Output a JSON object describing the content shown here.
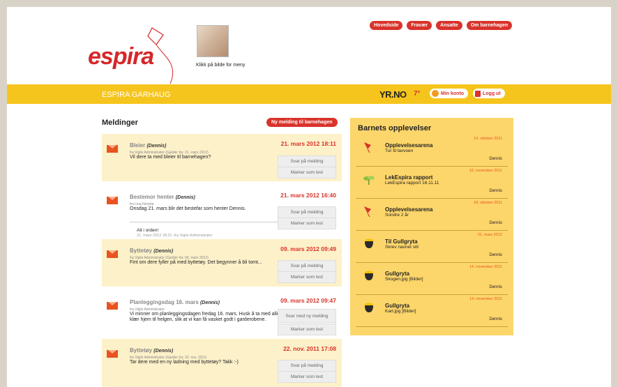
{
  "header": {
    "logo_text": "espira",
    "avatar_caption": "Klikk på bilde for meny",
    "nav": [
      "Hovedside",
      "Fravær",
      "Ansatte",
      "Om barnehagen"
    ]
  },
  "bar": {
    "title": "ESPIRA GARHAUG",
    "yr": "YR.NO",
    "temperature": "7°",
    "account": "Min konto",
    "logout": "Logg ut"
  },
  "messages": {
    "title": "Meldinger",
    "new_button": "Ny melding til barnehagen",
    "items": [
      {
        "subject": "Bleier",
        "child": "(Dennis)",
        "from": "fra Vigilo Administrator (Gjelder fra: 21. mars 2012)",
        "body": "Vil dere ta med bleier til barnehagen?",
        "date": "21. mars 2012 18:11",
        "reply": "Svar på melding",
        "mark": "Marker som lest"
      },
      {
        "subject": "Bestemor henter",
        "child": "(Dennis)",
        "from": "fra Lina Noreba",
        "body": "Onsdag 21. mars blir det bestefar som henter Dennis.",
        "date": "21. mars 2012 16:40",
        "reply": "Svar på melding",
        "mark": "Marker som lest",
        "answer_text": "Alt i orden!",
        "answer_meta": "21. mars 2012 18:21, fra Vigilo Administrator"
      },
      {
        "subject": "Byttetøy",
        "child": "(Dennis)",
        "from": "fra Vigilo Administrator (Gjelder fra: 09. mars 2012)",
        "body": "Fint om dere fyller på med byttetøy. Det begynner å bli tomt...",
        "date": "09. mars 2012 09:49",
        "reply": "Svar på melding",
        "mark": "Marker som lest"
      },
      {
        "subject": "Planleggingsdag 16. mars",
        "child": "(Dennis)",
        "from": "fra Vigilo Administrator",
        "body": "Vi minner om planleggingsdagen fredag 16. mars. Husk å ta med alle klær hjem til helgen, slik at vi kan få vasket godt i garderobene.",
        "date": "09. mars 2012 09:47",
        "reply": "Svar med ny melding",
        "mark": "Marker som lest"
      },
      {
        "subject": "Byttetøy",
        "child": "(Dennis)",
        "from": "fra Vigilo Administrator (Gjelder fra: 22. nov. 2011)",
        "body": "Tar dere med en ny ladning med byttetøy? Takk :-)",
        "date": "22. nov. 2011 17:08",
        "reply": "Svar på melding",
        "mark": "Marker som lest"
      }
    ]
  },
  "experiences": {
    "title": "Barnets opplevelser",
    "items": [
      {
        "title": "Opplevelsesarena",
        "subtitle": "Tur til lavvoen",
        "date": "14. oktober 2011",
        "child": "Dennis",
        "icon": "kite-icon"
      },
      {
        "title": "LekEspira rapport",
        "subtitle": "LekEspira rapport 16.11.11",
        "date": "16. november 2011",
        "child": "Dennis",
        "icon": "sprout-icon"
      },
      {
        "title": "Opplevelsesarena",
        "subtitle": "Sondre 2 år",
        "date": "18. oktober 2011",
        "child": "Dennis",
        "icon": "kite-icon"
      },
      {
        "title": "Til Gullgryta",
        "subtitle": "Skrev navnet sitt",
        "date": "21. mars 2012",
        "child": "Dennis",
        "icon": "pot-icon"
      },
      {
        "title": "Gullgryta",
        "subtitle": "Skogen.jpg [Bilder]",
        "date": "14. november 2011",
        "child": "Dennis",
        "icon": "pot-icon"
      },
      {
        "title": "Gullgryta",
        "subtitle": "Kart.jpg [Bilder]",
        "date": "14. november 2011",
        "child": "Dennis",
        "icon": "pot-icon"
      }
    ]
  },
  "colors": {
    "accent": "#d9332b",
    "bar": "#f6c51d",
    "panel": "#fdd66b",
    "unread": "#fdf1c9"
  }
}
